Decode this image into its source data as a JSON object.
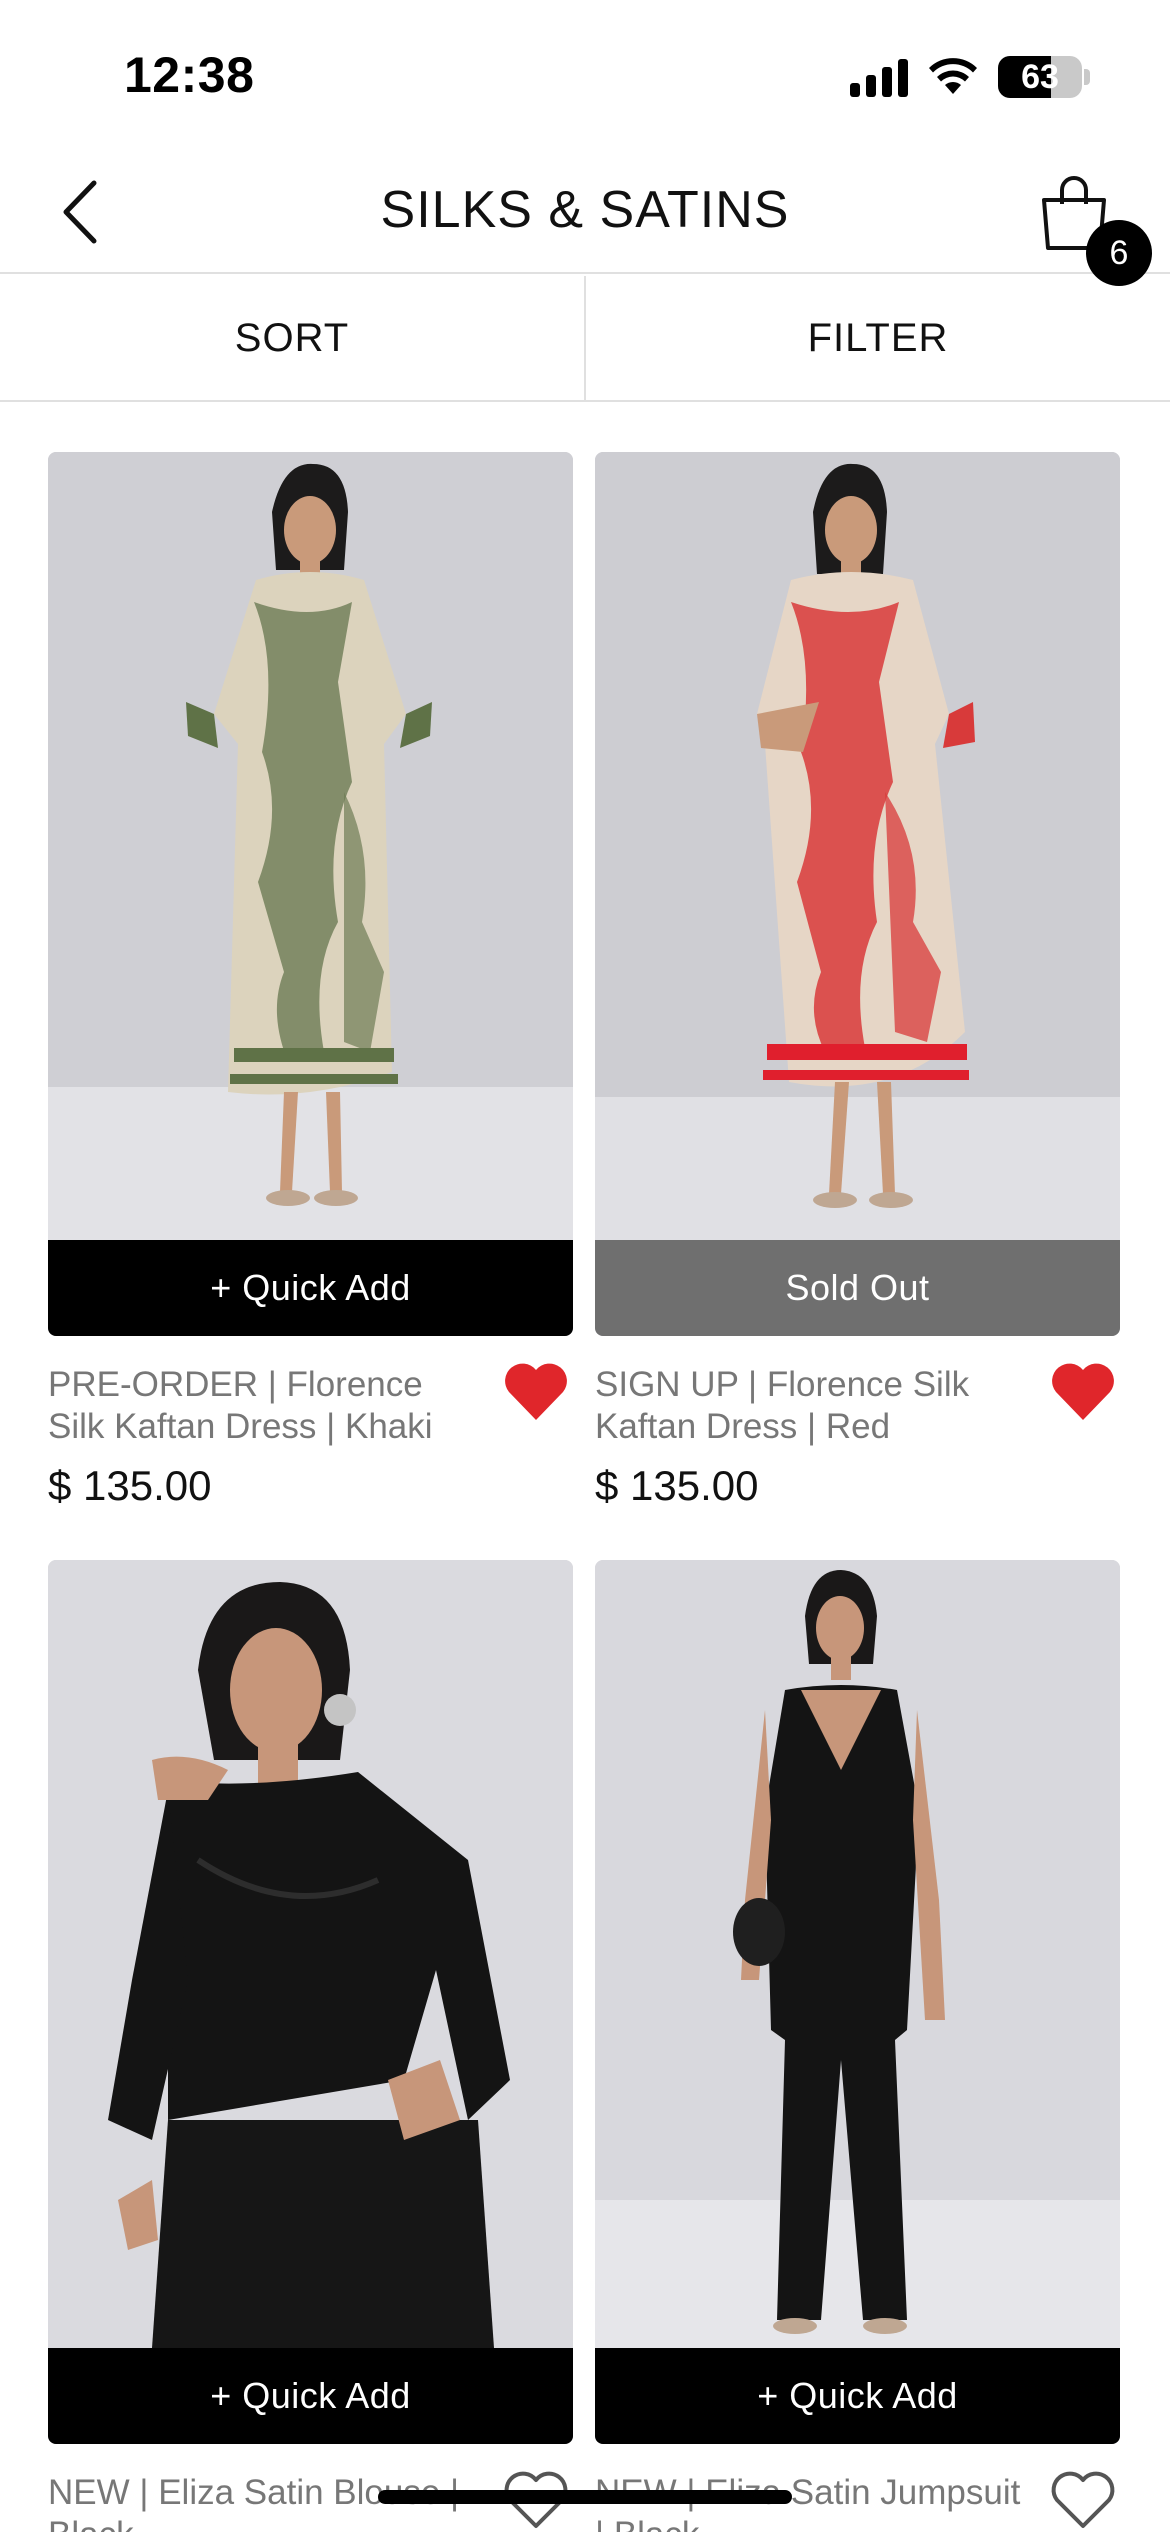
{
  "status_bar": {
    "time": "12:38",
    "battery": "63",
    "battery_level": 0.63
  },
  "header": {
    "title": "SILKS & SATINS",
    "cart_count": "6"
  },
  "toolbar": {
    "sort_label": "SORT",
    "filter_label": "FILTER"
  },
  "products": [
    {
      "name": "PRE-ORDER | Florence Silk Kaftan Dress | Khaki",
      "price": "$ 135.00",
      "button": "+ Quick Add",
      "favorited": true
    },
    {
      "name": "SIGN UP | Florence Silk Kaftan Dress | Red",
      "price": "$ 135.00",
      "button": "Sold Out",
      "favorited": true
    },
    {
      "name": "NEW | Eliza Satin Blouse | Black",
      "price": "",
      "button": "+ Quick Add",
      "favorited": false
    },
    {
      "name": "NEW | Eliza Satin Jumpsuit | Black",
      "price": "",
      "button": "+ Quick Add",
      "favorited": false
    }
  ],
  "colors": {
    "favorite_red": "#e0262b",
    "sold_out_gray": "#6f6f6f",
    "khaki_print": "#5f7247",
    "red_print": "#d83a3a",
    "black_satin": "#141414"
  },
  "icons": {
    "back": "chevron-left-icon",
    "cart": "shopping-bag-icon",
    "favorite_on": "heart-filled-icon",
    "favorite_off": "heart-outline-icon"
  }
}
